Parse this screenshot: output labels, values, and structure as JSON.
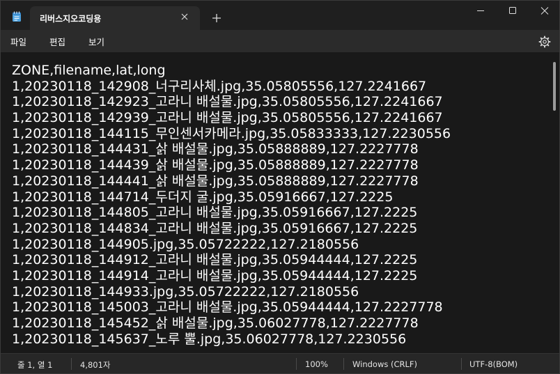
{
  "tab": {
    "title": "리버스지오코딩용"
  },
  "menu": {
    "items": [
      "파일",
      "편집",
      "보기"
    ]
  },
  "icons": {
    "app": "notepad-icon",
    "close": "close-icon",
    "new_tab": "plus-icon",
    "minimize": "minimize-icon",
    "maximize": "maximize-icon",
    "window_close": "close-icon",
    "settings": "gear-icon"
  },
  "editor": {
    "lines": [
      "ZONE,filename,lat,long",
      "1,20230118_142908_너구리사체.jpg,35.05805556,127.2241667",
      "1,20230118_142923_고라니 배설물.jpg,35.05805556,127.2241667",
      "1,20230118_142939_고라니 배설물.jpg,35.05805556,127.2241667",
      "1,20230118_144115_무인센서카메라.jpg,35.05833333,127.2230556",
      "1,20230118_144431_삵 배설물.jpg,35.05888889,127.2227778",
      "1,20230118_144439_삵 배설물.jpg,35.05888889,127.2227778",
      "1,20230118_144441_삵 배설물.jpg,35.05888889,127.2227778",
      "1,20230118_144714_두더지 굴.jpg,35.05916667,127.2225",
      "1,20230118_144805_고라니 배설물.jpg,35.05916667,127.2225",
      "1,20230118_144834_고라니 배설물.jpg,35.05916667,127.2225",
      "1,20230118_144905.jpg,35.05722222,127.2180556",
      "1,20230118_144912_고라니 배설물.jpg,35.05944444,127.2225",
      "1,20230118_144914_고라니 배설물.jpg,35.05944444,127.2225",
      "1,20230118_144933.jpg,35.05722222,127.2180556",
      "1,20230118_145003_고라니 배설물.jpg,35.05944444,127.2227778",
      "1,20230118_145452_삵 배설물.jpg,35.06027778,127.2227778",
      "1,20230118_145637_노루 뿔.jpg,35.06027778,127.2230556"
    ]
  },
  "status": {
    "position": "줄 1, 열 1",
    "char_count": "4,801자",
    "zoom": "100%",
    "line_ending": "Windows (CRLF)",
    "encoding": "UTF-8(BOM)"
  }
}
